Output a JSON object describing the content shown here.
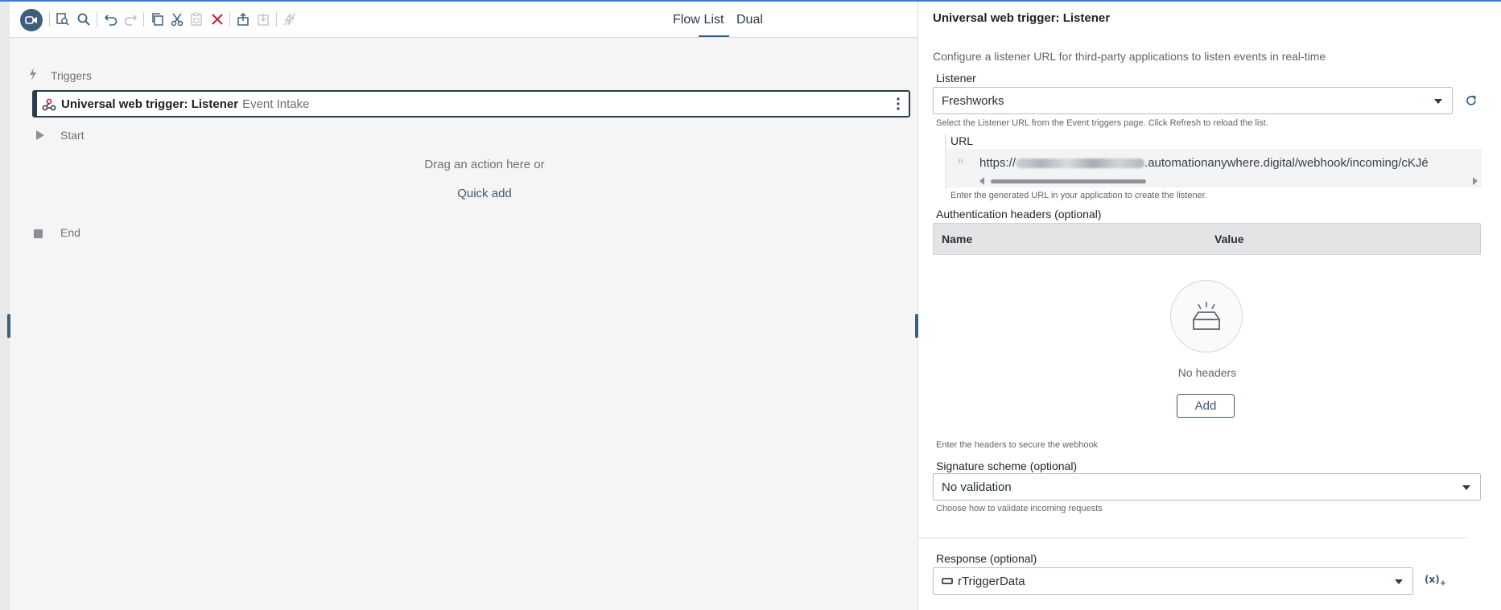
{
  "toolbar": {
    "buttons": [
      "record-icon",
      "search-page-icon",
      "search-icon",
      "undo-icon",
      "redo-icon",
      "copy-icon",
      "cut-icon",
      "paste-icon",
      "delete-icon",
      "export-icon",
      "import-icon",
      "disable-icon"
    ],
    "views": {
      "flow": "Flow",
      "list": "List",
      "dual": "Dual",
      "active": "List"
    }
  },
  "canvas": {
    "triggers_label": "Triggers",
    "trigger": {
      "title": "Universal web trigger: Listener",
      "subtitle": "Event Intake"
    },
    "start_label": "Start",
    "drop_hint": "Drag an action here or",
    "quick_add": "Quick add",
    "end_label": "End"
  },
  "panel": {
    "title": "Universal web trigger: Listener",
    "description": "Configure a listener URL for third-party applications to listen events in real-time",
    "listener": {
      "label": "Listener",
      "value": "Freshworks",
      "help": "Select the Listener URL from the Event triggers page. Click Refresh to reload the list."
    },
    "url": {
      "label": "URL",
      "prefix": "https://",
      "suffix": ".automationanywhere.digital/webhook/incoming/cKJé",
      "help": "Enter the generated URL in your application to create the listener."
    },
    "auth_headers": {
      "label": "Authentication headers (optional)",
      "columns": {
        "name": "Name",
        "value": "Value"
      },
      "empty_text": "No headers",
      "add_label": "Add",
      "help": "Enter the headers to secure the webhook"
    },
    "signature": {
      "label": "Signature scheme (optional)",
      "value": "No validation",
      "help": "Choose how to validate incoming requests"
    },
    "response": {
      "label": "Response (optional)",
      "value": "rTriggerData",
      "fx": "(x)"
    }
  },
  "colors": {
    "accent": "#2f5c86",
    "rec_button": "#3e5f7c",
    "delete": "#c0262d",
    "border_top": "#3b7bd6"
  }
}
